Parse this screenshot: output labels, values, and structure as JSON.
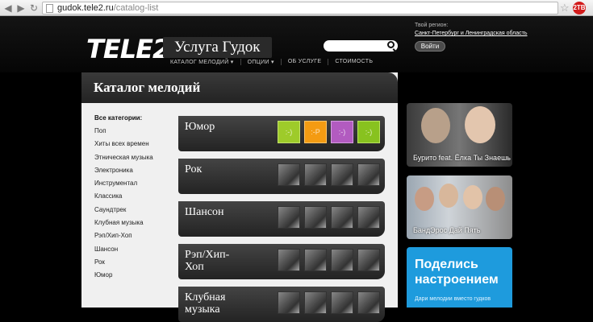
{
  "browser": {
    "url_host": "gudok.tele2.ru",
    "url_path": "/catalog-list",
    "ext_badge": "2TB"
  },
  "header": {
    "logo": "TELE2",
    "service_title": "Услуга Гудок",
    "search_placeholder": "",
    "menu": [
      "КАТАЛОГ МЕЛОДИЙ ▾",
      "ОПЦИИ ▾",
      "ОБ УСЛУГЕ",
      "СТОИМОСТЬ"
    ],
    "region_label": "Твой регион:",
    "region_value": "Санкт-Петербург и Ленинградская область",
    "login_label": "Войти"
  },
  "catalog": {
    "title": "Каталог мелодий",
    "categories_heading": "Все категории:",
    "categories": [
      "Поп",
      "Хиты всех времен",
      "Этническая музыка",
      "Электроника",
      "Инструментал",
      "Классика",
      "Саундтрек",
      "Клубная музыка",
      "Рэп/Хип-Хоп",
      "Шансон",
      "Рок",
      "Юмор"
    ],
    "genres": [
      {
        "label": "Юмор",
        "thumbs": [
          "lime",
          "orange",
          "purple",
          "green"
        ]
      },
      {
        "label": "Рок",
        "thumbs": [
          "gray",
          "gray",
          "gray",
          "gray"
        ]
      },
      {
        "label": "Шансон",
        "thumbs": [
          "gray",
          "gray",
          "gray",
          "gray"
        ]
      },
      {
        "label": "Рэп/Хип-Хоп",
        "thumbs": [
          "gray",
          "gray",
          "gray",
          "gray"
        ]
      },
      {
        "label": "Клубная музыка",
        "thumbs": [
          "gray",
          "gray",
          "gray",
          "gray"
        ]
      }
    ]
  },
  "promos": {
    "promo1_caption": "Бурито feat. Ёлка Ты Знаешь",
    "promo2_caption": "БандЭрос Дай Пять",
    "share_title": "Поделись настроением",
    "share_sub": "Дари мелодии вместо гудков"
  },
  "colors": {
    "accent_blue": "#1e9bdd",
    "header_bg": "#0d0d0d",
    "panel_bg": "#f0f0f0"
  }
}
